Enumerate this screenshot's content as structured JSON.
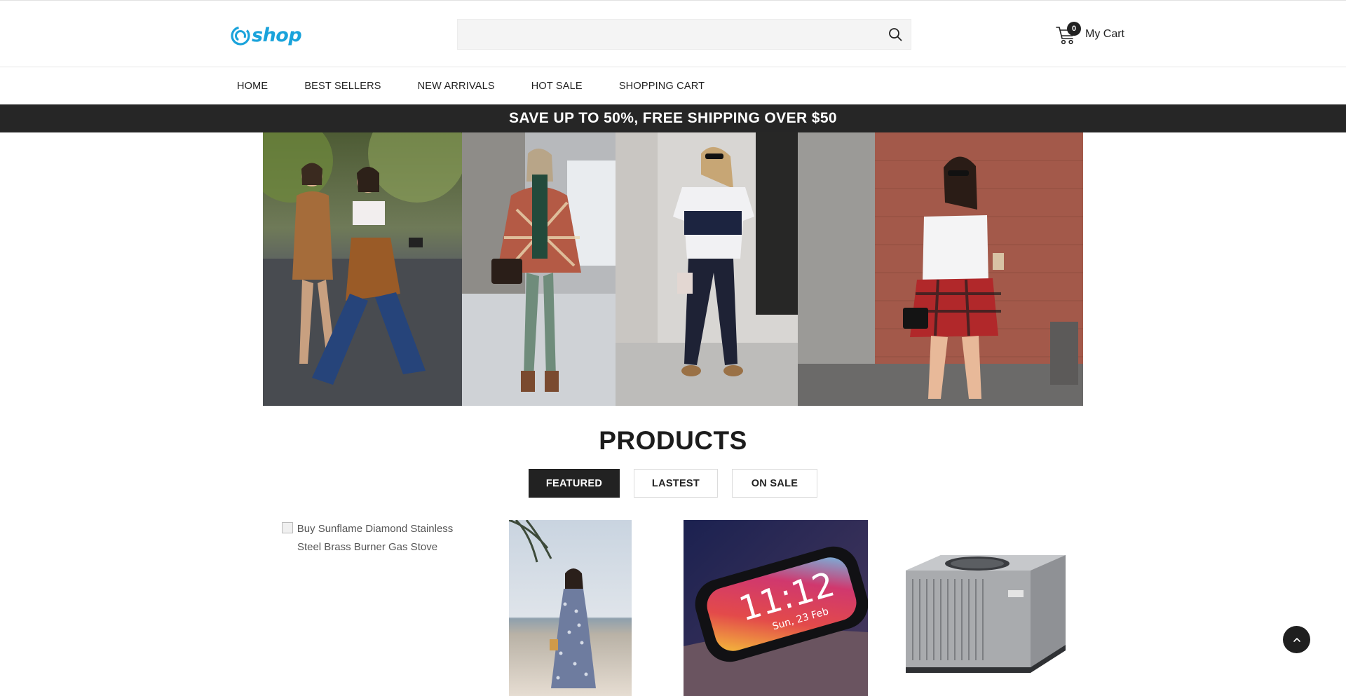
{
  "header": {
    "logo_text": "shop",
    "search": {
      "value": "",
      "placeholder": ""
    },
    "cart": {
      "count": "0",
      "label": "My Cart"
    }
  },
  "nav": {
    "items": [
      {
        "label": "HOME"
      },
      {
        "label": "BEST SELLERS"
      },
      {
        "label": "NEW ARRIVALS"
      },
      {
        "label": "HOT SALE"
      },
      {
        "label": "SHOPPING CART"
      }
    ]
  },
  "promo": {
    "text": "SAVE UP TO 50%, FREE SHIPPING OVER $50"
  },
  "products": {
    "title": "PRODUCTS",
    "tabs": [
      {
        "label": "FEATURED",
        "active": true
      },
      {
        "label": "LASTEST",
        "active": false
      },
      {
        "label": "ON SALE",
        "active": false
      }
    ],
    "items": [
      {
        "alt_text": "Buy Sunflame Diamond Stainless Steel Brass Burner Gas Stove",
        "image": "broken-image"
      },
      {
        "image": "woman-floral-dress-beach-photo"
      },
      {
        "image": "smartwatch-display-photo",
        "watch_time": "11:12",
        "watch_date": "Sun, 23 Feb"
      },
      {
        "image": "air-conditioner-unit-photo"
      }
    ]
  },
  "icons": {
    "search": "search-icon",
    "cart": "cart-icon",
    "scroll_top": "chevron-up-icon"
  },
  "colors": {
    "brand": "#1aa3db",
    "promo_bg": "#262626",
    "tab_active_bg": "#222222"
  }
}
